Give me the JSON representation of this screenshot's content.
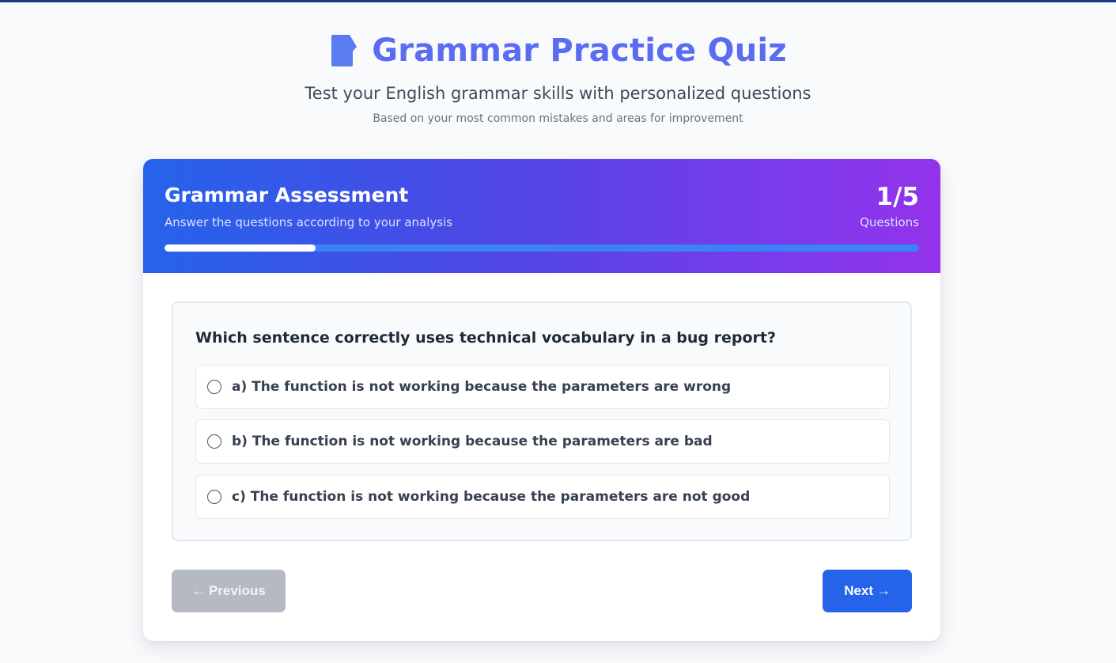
{
  "header": {
    "icon": "document-icon",
    "title": "Grammar Practice Quiz",
    "subtitle": "Test your English grammar skills with personalized questions",
    "note": "Based on your most common mistakes and areas for improvement"
  },
  "assessment": {
    "title": "Grammar Assessment",
    "subtitle": "Answer the questions according to your analysis",
    "progress_text": "1/5",
    "progress_label": "Questions",
    "progress_fraction": 0.2,
    "colors": {
      "gradient_start": "#2563eb",
      "gradient_end": "#9333ea",
      "track": "#3b82f6"
    }
  },
  "question": {
    "text": "Which sentence correctly uses technical vocabulary in a bug report?",
    "options": [
      {
        "label": "a) The function is not working because the parameters are wrong",
        "selected": false
      },
      {
        "label": "b) The function is not working because the parameters are bad",
        "selected": false
      },
      {
        "label": "c) The function is not working because the parameters are not good",
        "selected": false
      }
    ]
  },
  "nav": {
    "previous_label": "← Previous",
    "previous_disabled": true,
    "next_label": "Next →",
    "accent": "#2563eb"
  }
}
